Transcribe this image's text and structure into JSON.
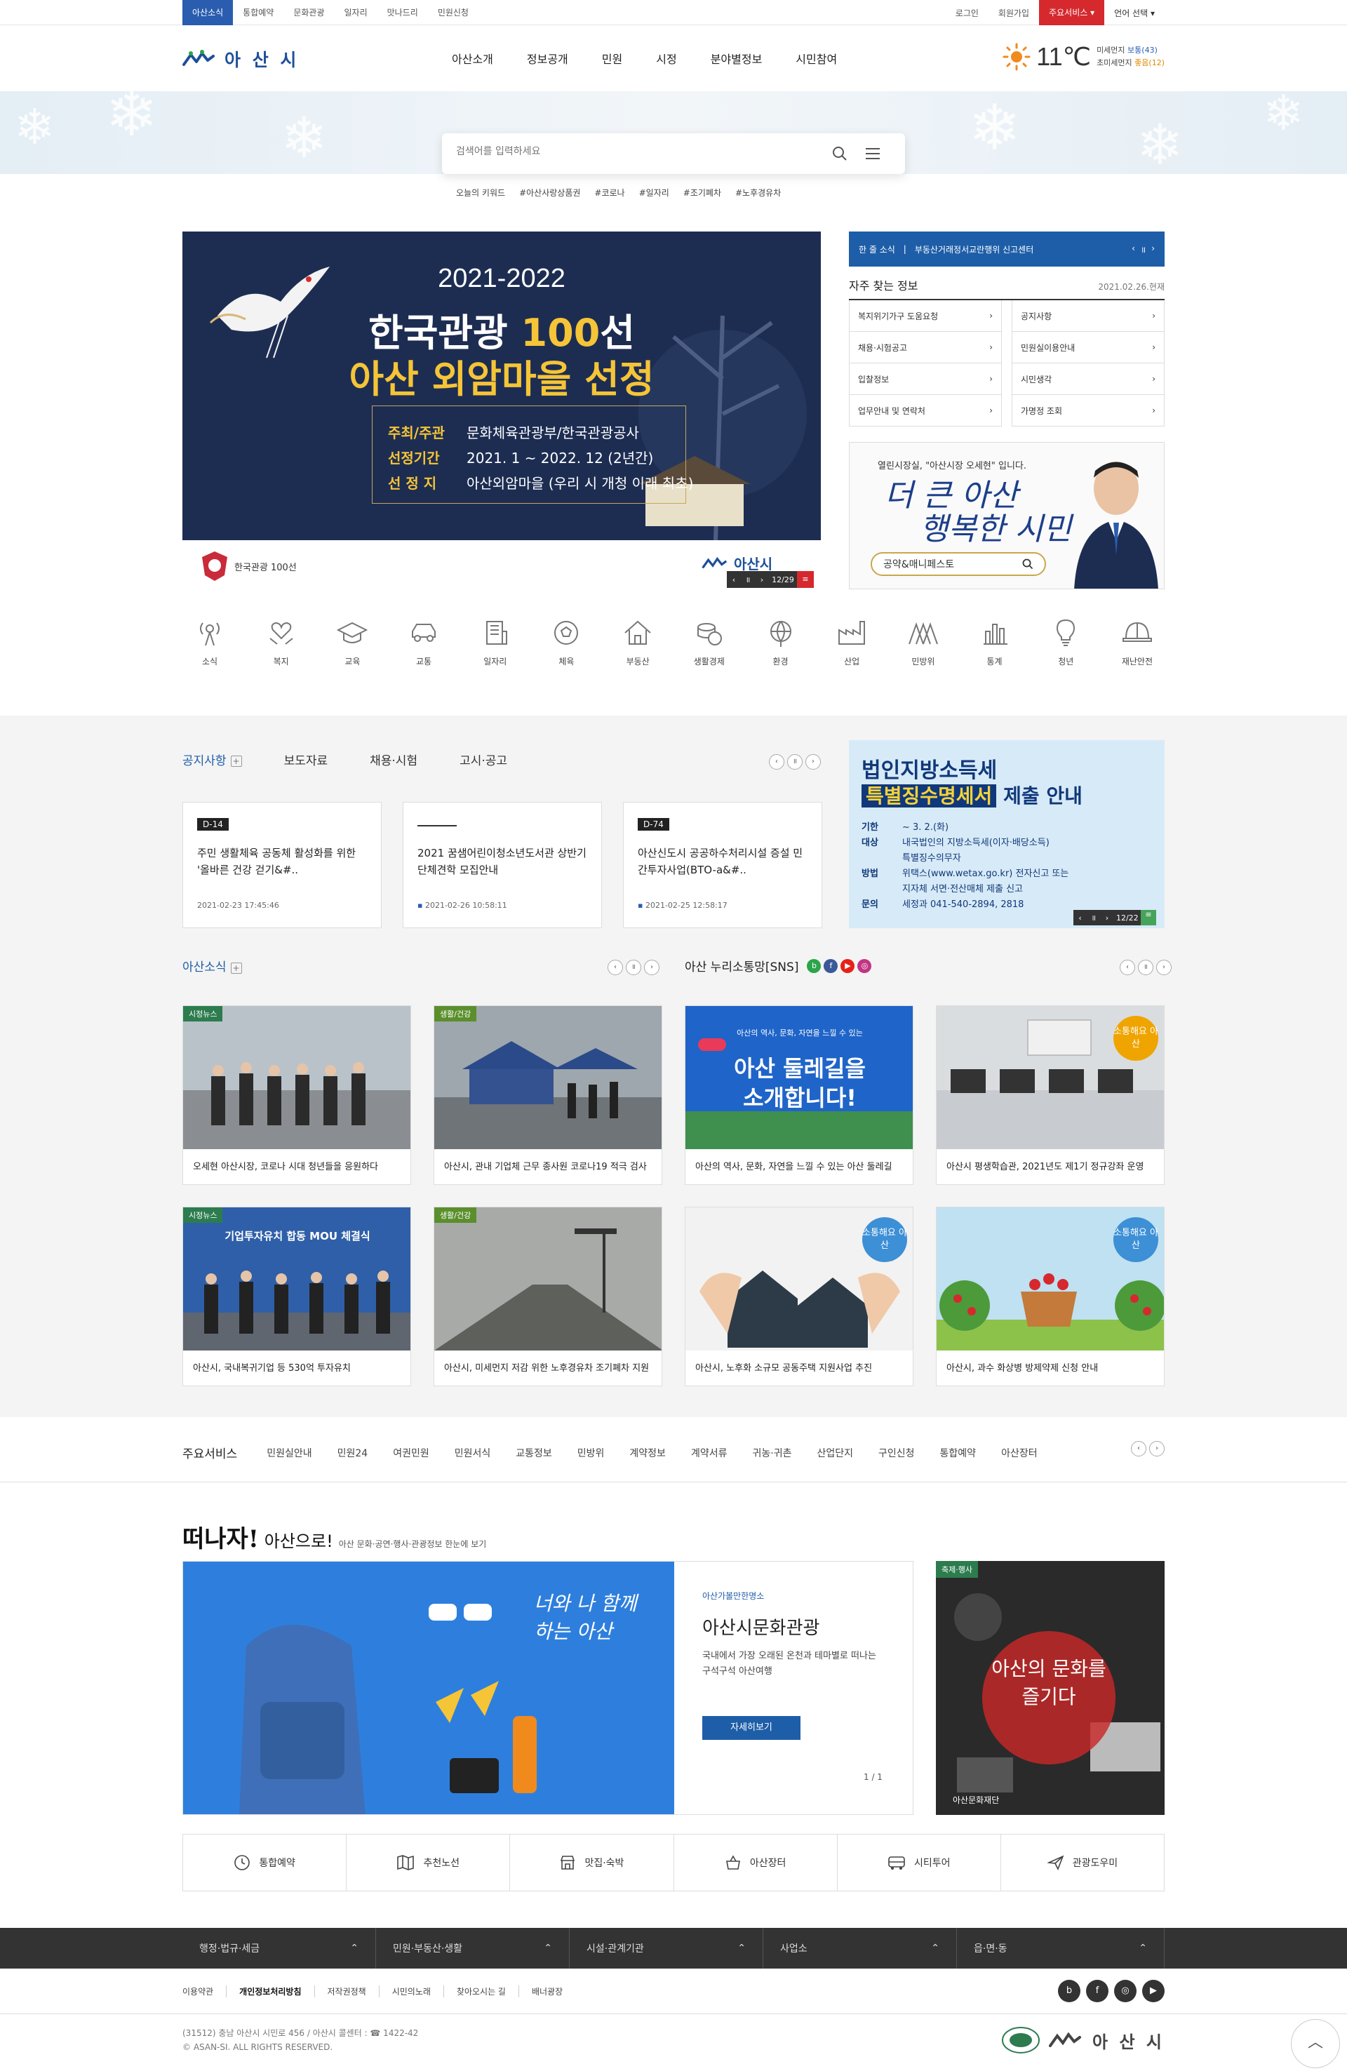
{
  "topbar": {
    "tabs": [
      "아산소식",
      "통합예약",
      "문화관광",
      "일자리",
      "맛나드리",
      "민원신청"
    ],
    "login": "로그인",
    "join": "회원가입",
    "main_service": "주요서비스",
    "language": "언어 선택"
  },
  "header": {
    "logo_text": "아 산 시",
    "gnb": [
      "아산소개",
      "정보공개",
      "민원",
      "시정",
      "분야별정보",
      "시민참여"
    ],
    "weather": {
      "temp": "11℃",
      "dust1_label": "미세먼지",
      "dust1_value": "보통(43)",
      "dust2_label": "초미세먼지",
      "dust2_value": "좋음(12)"
    }
  },
  "search": {
    "placeholder": "검색어를 입력하세요",
    "keyword_label": "오늘의 키워드",
    "keywords": [
      "#아산사랑상품권",
      "#코로나",
      "#일자리",
      "#조기폐차",
      "#노후경유차"
    ]
  },
  "banner": {
    "year": "2021-2022",
    "title_a": "한국관광 ",
    "title_b": "100",
    "title_c": "선",
    "title2": "아산 외암마을 선정",
    "rows": [
      {
        "k": "주최/주관",
        "v": "문화체육관광부/한국관광공사"
      },
      {
        "k": "선정기간",
        "v": "2021. 1 ~ 2022. 12 (2년간)"
      },
      {
        "k": "선 정 지",
        "v": "아산외암마을 (우리 시 개청 이래 최초)"
      }
    ],
    "badge_text": "한국관광 100선",
    "logo_text": "아산시",
    "counter": "12/29"
  },
  "one_news": {
    "label": "한 줄 소식",
    "text": "부동산거래정서교란행위 신고센터"
  },
  "favorites": {
    "title": "자주 찾는 정보",
    "date": "2021.02.26.현재",
    "items": [
      "복지위기가구 도움요청",
      "공지사항",
      "채용·시험공고",
      "민원실이용안내",
      "입찰정보",
      "시민생각",
      "업무안내 및 연락처",
      "가명정 조회"
    ]
  },
  "mayor": {
    "text": "열린시장실, \"아산시장 오세현\" 입니다.",
    "slogan1": "더 큰 아산",
    "slogan2": "행복한 시민",
    "search_label": "공약&매니페스토"
  },
  "categories": [
    "소식",
    "복지",
    "교육",
    "교통",
    "일자리",
    "체육",
    "부동산",
    "생활경제",
    "환경",
    "산업",
    "민방위",
    "통계",
    "청년",
    "재난안전"
  ],
  "notice": {
    "tabs": [
      "공지사항",
      "보도자료",
      "채용·시험",
      "고시·공고"
    ],
    "cards": [
      {
        "dday": "D-14",
        "title": "주민 생활체육 공동체 활성화를 위한 '올바른 건강 걷기&#..",
        "date": "2021-02-23 17:45:46"
      },
      {
        "dday": "",
        "title": "2021 꿈샘어린이청소년도서관 상반기 단체견학 모집안내",
        "date": "2021-02-26 10:58:11"
      },
      {
        "dday": "D-74",
        "title": "아산신도시 공공하수처리시설 증설 민간투자사업(BTO-a&#..",
        "date": "2021-02-25 12:58:17"
      }
    ]
  },
  "tax": {
    "title1": "법인지방소득세",
    "title2a": "특별징수명세서",
    "title2b": " 제출 안내",
    "rows": [
      {
        "k": "기한",
        "v": "~ 3. 2.(화)"
      },
      {
        "k": "대상",
        "v": "내국법인의 지방소득세(이자·배당소득)"
      },
      {
        "k": "",
        "v": "특별징수의무자"
      },
      {
        "k": "방법",
        "v": "위택스(www.wetax.go.kr) 전자신고 또는"
      },
      {
        "k": "",
        "v": "지자체 서면·전산매체 제출 신고"
      },
      {
        "k": "문의",
        "v": "세정과 041-540-2894, 2818"
      }
    ],
    "counter": "12/22"
  },
  "asan_news": {
    "title": "아산소식",
    "sns_title": "아산 누리소통망[SNS]",
    "cards": [
      {
        "tag": "시정뉴스",
        "caption": "오세현 아산시장, 코로나 시대 청년들을 응원하다"
      },
      {
        "tag": "생활/건강",
        "caption": "아산시, 관내 기업체 근무 종사원 코로나19 적극 검사"
      },
      {
        "tag": "",
        "caption": "아산의 역사, 문화, 자연을 느낄 수 있는 아산 둘레길"
      },
      {
        "tag": "",
        "caption": "아산시 평생학습관, 2021년도 제1기 정규강좌 운영"
      },
      {
        "tag": "시정뉴스",
        "caption": "아산시, 국내복귀기업 등 530억 투자유치"
      },
      {
        "tag": "생활/건강",
        "caption": "아산시, 미세먼지 저감 위한 노후경유차 조기폐차 지원"
      },
      {
        "tag": "",
        "caption": "아산시, 노후화 소규모 공동주택 지원사업 추진"
      },
      {
        "tag": "",
        "caption": "아산시, 과수 화상병 방제약제 신청 안내"
      }
    ],
    "sns_img_text1": "아산의 역사, 문화, 자연을 느낄 수 있는",
    "sns_img_text2": "아산 둘레길을",
    "sns_img_text3": "소개합니다!",
    "sns_badge": "소통해요 아산",
    "mou_text": "기업투자유치 합동 MOU 체결식"
  },
  "services": {
    "title": "주요서비스",
    "items": [
      "민원실안내",
      "민원24",
      "여권민원",
      "민원서식",
      "교통정보",
      "민방위",
      "계약정보",
      "계약서류",
      "귀농·귀촌",
      "산업단지",
      "구인신청",
      "통합예약",
      "아산장터"
    ]
  },
  "tour": {
    "head1": "떠나자!",
    "head2": "아산으로!",
    "sub": "아산 문화·공연·행사·관광정보 한눈에 보기",
    "img_text": "너와 나 함께하는 아산",
    "small": "아산가볼만한명소",
    "big": "아산시문화관광",
    "desc": "국내에서 가장 오래된 온천과 테마별로 떠나는 구석구석 아산여행",
    "btn": "자세히보기",
    "page": "1 / 1",
    "fest_tag": "축제·행사",
    "fest_circle": "아산의 문화를 즐기다",
    "fest_caption": "아산문화재단"
  },
  "quick": [
    "통합예약",
    "추천노선",
    "맛집·숙박",
    "아산장터",
    "시티투어",
    "관광도우미"
  ],
  "footer": {
    "bar": [
      "행정·법규·세금",
      "민원·부동산·생활",
      "시설·관계기관",
      "사업소",
      "읍·면·동"
    ],
    "links": [
      "이용약관",
      "개인정보처리방침",
      "저작권정책",
      "시민의노래",
      "찾아오시는 길",
      "배너광장"
    ],
    "address": "(31512) 충남 아산시 시민로 456 / 아산시 콜센터 : ☎ 1422-42",
    "copyright": "© ASAN-SI. ALL RIGHTS RESERVED.",
    "logo_text": "아 산 시"
  },
  "colors": {
    "brand_blue": "#1e5ea8",
    "accent_red": "#d5292e",
    "banner_navy": "#1d2d52",
    "gold": "#f5c437"
  }
}
